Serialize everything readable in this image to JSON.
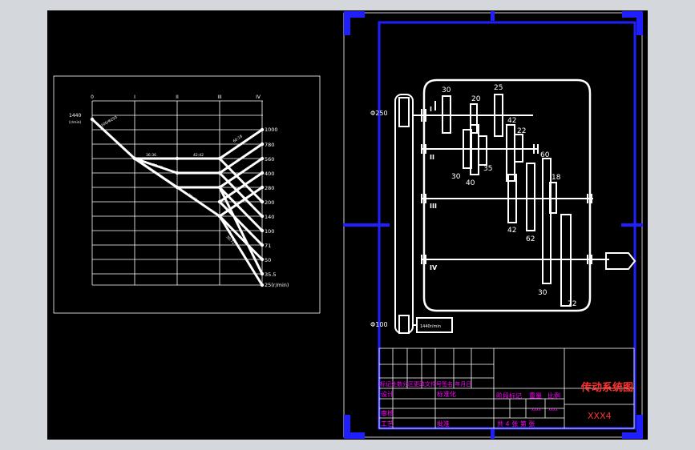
{
  "speed_chart": {
    "shaft_labels": [
      "0",
      "I",
      "II",
      "III",
      "IV"
    ],
    "motor_speed": "1440",
    "motor_unit": "(r/min)",
    "output_speeds": [
      "1000",
      "780",
      "560",
      "400",
      "280",
      "200",
      "140",
      "100",
      "71",
      "50",
      "35.5",
      "25(r/min)"
    ],
    "ratio_labels": [
      "Φ100/Φ250",
      "36:36",
      "42:42",
      "30:42",
      "20:40",
      "60:18",
      "30:72"
    ]
  },
  "drive_diagram": {
    "pulley_top": "Φ250",
    "pulley_bottom": "Φ100",
    "motor": "1440r/min",
    "shaft_labels": [
      "I",
      "II",
      "III",
      "IV"
    ],
    "gear_teeth": [
      "30",
      "25",
      "20",
      "42",
      "22",
      "30",
      "40",
      "35",
      "60",
      "18",
      "42",
      "62",
      "30",
      "72"
    ]
  },
  "title_block": {
    "drawing_title": "传动系统图",
    "drawing_code": "XXX4",
    "revision_row": "标记处数分区更改文件号签名 年月日",
    "designer": "设计",
    "standardization": "标准化",
    "review": "审核",
    "process": "工艺",
    "approve": "批准",
    "stage_marks": "阶段标记",
    "weight": "重量",
    "scale": "比例",
    "weight_value": "xxxx",
    "scale_value": "xxxx",
    "sheets": "共 4 张 第   张"
  }
}
